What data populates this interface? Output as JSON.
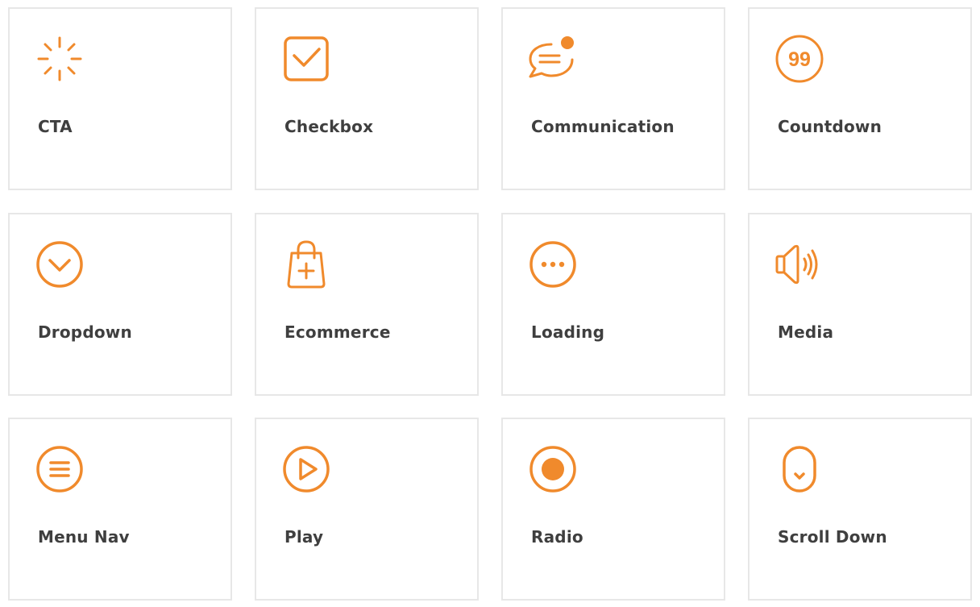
{
  "accent_color": "#f08a2c",
  "cards": [
    {
      "label": "CTA",
      "icon": "cta-burst-icon"
    },
    {
      "label": "Checkbox",
      "icon": "checkbox-icon"
    },
    {
      "label": "Communication",
      "icon": "chat-bubble-icon"
    },
    {
      "label": "Countdown",
      "icon": "countdown-99-icon"
    },
    {
      "label": "Dropdown",
      "icon": "chevron-circle-icon"
    },
    {
      "label": "Ecommerce",
      "icon": "shopping-bag-icon"
    },
    {
      "label": "Loading",
      "icon": "loading-dots-icon"
    },
    {
      "label": "Media",
      "icon": "speaker-icon"
    },
    {
      "label": "Menu Nav",
      "icon": "menu-lines-icon"
    },
    {
      "label": "Play",
      "icon": "play-icon"
    },
    {
      "label": "Radio",
      "icon": "radio-icon"
    },
    {
      "label": "Scroll Down",
      "icon": "scroll-down-icon"
    }
  ]
}
